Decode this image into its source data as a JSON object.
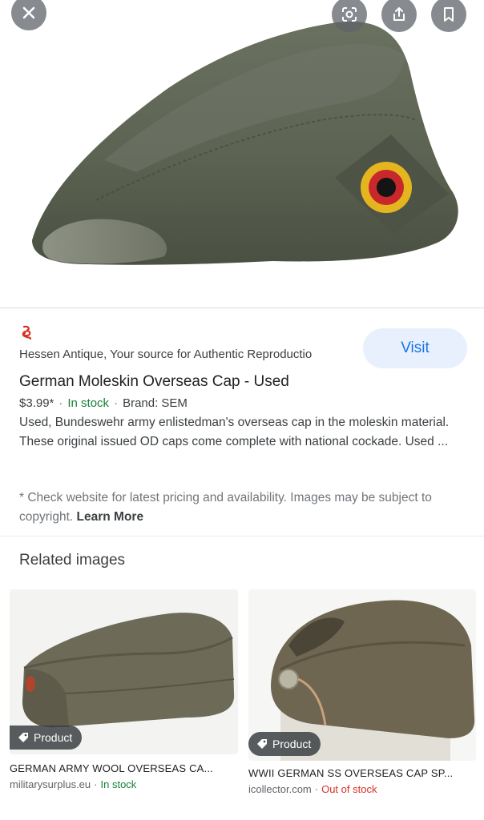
{
  "viewer": {
    "close_icon": "close-icon",
    "lens_icon": "google-lens-icon",
    "share_icon": "share-icon",
    "save_icon": "bookmark-icon",
    "overlay_color": "#5f6368"
  },
  "result": {
    "source_name": "Hessen Antique, Your source for Authentic Reproductio",
    "source_logo_color": "#d93025",
    "visit_label": "Visit",
    "title": "German Moleskin Overseas Cap - Used",
    "price": "$3.99*",
    "stock": "In stock",
    "brand": "Brand: SEM",
    "description": "Used, Bundeswehr army enlistedman's overseas cap in the moleskin material. These original issued OD caps come complete with national cockade. Used ...",
    "disclaimer": "* Check website for latest pricing and availability. Images may be subject to copyright.",
    "learn_more": "Learn More"
  },
  "related": {
    "heading": "Related images",
    "items": [
      {
        "chip": "Product",
        "title": "GERMAN ARMY WOOL OVERSEAS CA...",
        "site": "militarysurplus.eu",
        "stock": "In stock"
      },
      {
        "chip": "Product",
        "title": "WWII GERMAN SS OVERSEAS CAP SP...",
        "site": "icollector.com",
        "stock": "Out of stock"
      }
    ]
  },
  "colors": {
    "accent": "#1a73e8",
    "in_stock": "#188038",
    "out_of_stock": "#d93025",
    "cap_olive": "#5e6450"
  }
}
